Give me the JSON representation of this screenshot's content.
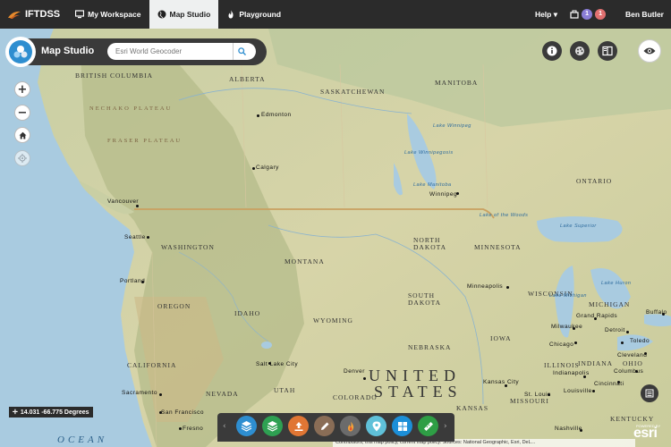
{
  "nav": {
    "brand": "IFTDSS",
    "tabs": [
      {
        "label": "My Workspace",
        "icon": "monitor-icon"
      },
      {
        "label": "Map Studio",
        "icon": "globe-icon",
        "active": true
      },
      {
        "label": "Playground",
        "icon": "flame-icon"
      }
    ],
    "help": "Help",
    "notifications": {
      "count_a": "1",
      "count_b": "1"
    },
    "user": "Ben Butler"
  },
  "studio": {
    "title": "Map Studio",
    "search_placeholder": "Esri World Geocoder"
  },
  "coords": "14.031 -66.775 Degrees",
  "attribution": "Contributors, this map policy, current map policy. Sources: National Geographic, Esri, DeL...",
  "esri": {
    "brand": "esri",
    "powered": "POWERED BY"
  },
  "colors": {
    "accent": "#2e8ed0",
    "nav_bg": "#2b2b2b"
  },
  "map_labels": {
    "states": {
      "british_columbia": "BRITISH COLUMBIA",
      "alberta": "ALBERTA",
      "saskatchewan": "SASKATCHEWAN",
      "manitoba": "MANITOBA",
      "ontario": "ONTARIO",
      "washington": "WASHINGTON",
      "montana": "MONTANA",
      "north_dakota_1": "NORTH",
      "north_dakota_2": "DAKOTA",
      "minnesota": "MINNESOTA",
      "south_dakota_1": "SOUTH",
      "south_dakota_2": "DAKOTA",
      "wisconsin": "WISCONSIN",
      "oregon": "OREGON",
      "idaho": "IDAHO",
      "wyoming": "WYOMING",
      "nebraska": "NEBRASKA",
      "iowa": "IOWA",
      "michigan": "MICHIGAN",
      "illinois": "ILLINOIS",
      "indiana": "INDIANA",
      "ohio": "OHIO",
      "kansas": "KANSAS",
      "missouri": "MISSOURI",
      "kentucky": "KENTUCKY",
      "california": "CALIFORNIA",
      "nevada": "NEVADA",
      "utah": "UTAH",
      "colorado": "COLORADO"
    },
    "country": {
      "united": "UNITED",
      "states": "STATES"
    },
    "ocean": "OCEAN",
    "regions": {
      "fraser": "FRASER PLATEAU",
      "nechako": "NECHAKO PLATEAU"
    },
    "lakes": {
      "winnipeg": "Lake Winnipeg",
      "winnipegosis": "Lake Winnipegosis",
      "manitoba": "Lake Manitoba",
      "superior": "Lake Superior",
      "woods": "Lake of the Woods",
      "michigan": "Lake Michigan",
      "huron": "Lake Huron"
    },
    "cities": {
      "edmonton": "Edmonton",
      "calgary": "Calgary",
      "vancouver": "Vancouver",
      "winnipeg": "Winnipeg",
      "seattle": "Seattle",
      "portland": "Portland",
      "minneapolis": "Minneapolis",
      "salt_lake": "Salt Lake City",
      "denver": "Denver",
      "sacramento": "Sacramento",
      "san_francisco": "San Francisco",
      "fresno": "Fresno",
      "kansas_city": "Kansas City",
      "st_louis": "St. Louis",
      "chicago": "Chicago",
      "milwaukee": "Milwaukee",
      "grand_rapids": "Grand Rapids",
      "detroit": "Detroit",
      "toledo": "Toledo",
      "cleveland": "Cleveland",
      "columbus": "Columbus",
      "indianapolis": "Indianapolis",
      "cincinnati": "Cincinnati",
      "louisville": "Louisville",
      "nashville": "Nashville",
      "buffalo": "Buffalo"
    }
  }
}
